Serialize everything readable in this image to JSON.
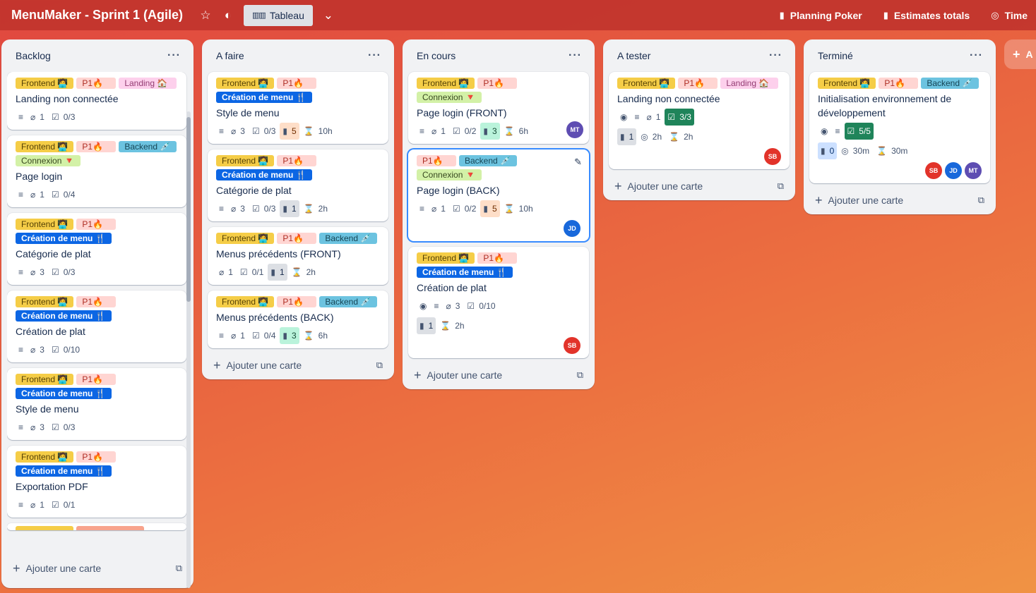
{
  "board": {
    "title": "MenuMaker - Sprint 1 (Agile)",
    "view": "Tableau",
    "powerups": [
      "Planning Poker",
      "Estimates totals",
      "Time"
    ]
  },
  "labels": {
    "frontend": "Frontend 🧑‍💻",
    "p1": "P1🔥",
    "landing": "Landing 🏠",
    "backend": "Backend 💉",
    "connexion": "Connexion 🔻",
    "creation": "Création de menu 🍴"
  },
  "add_card": "Ajouter une carte",
  "add_list": "A",
  "lists": [
    {
      "title": "Backlog",
      "cards": [
        {
          "title": "Landing non connectée",
          "attachments": "1",
          "checklist": "0/3"
        },
        {
          "title": "Page login",
          "attachments": "1",
          "checklist": "0/4"
        },
        {
          "title": "Catégorie de plat",
          "attachments": "3",
          "checklist": "0/3"
        },
        {
          "title": "Création de plat",
          "attachments": "3",
          "checklist": "0/10"
        },
        {
          "title": "Style de menu",
          "attachments": "3",
          "checklist": "0/3"
        },
        {
          "title": "Exportation PDF",
          "attachments": "1",
          "checklist": "0/1"
        }
      ]
    },
    {
      "title": "A faire",
      "cards": [
        {
          "title": "Style de menu",
          "attachments": "3",
          "checklist": "0/3",
          "points": "5",
          "time": "10h"
        },
        {
          "title": "Catégorie de plat",
          "attachments": "3",
          "checklist": "0/3",
          "points": "1",
          "time": "2h"
        },
        {
          "title": "Menus précédents (FRONT)",
          "attachments": "1",
          "checklist": "0/1",
          "points": "1",
          "time": "2h"
        },
        {
          "title": "Menus précédents (BACK)",
          "attachments": "1",
          "checklist": "0/4",
          "points": "3",
          "time": "6h"
        }
      ]
    },
    {
      "title": "En cours",
      "cards": [
        {
          "title": "Page login (FRONT)",
          "attachments": "1",
          "checklist": "0/2",
          "points": "3",
          "time": "6h",
          "member": "MT"
        },
        {
          "title": "Page login (BACK)",
          "attachments": "1",
          "checklist": "0/2",
          "points": "5",
          "time": "10h",
          "member": "JD"
        },
        {
          "title": "Création de plat",
          "attachments": "3",
          "checklist": "0/10",
          "points": "1",
          "time": "2h",
          "member": "SB"
        }
      ]
    },
    {
      "title": "A tester",
      "cards": [
        {
          "title": "Landing non connectée",
          "attachments": "1",
          "checklist": "3/3",
          "points": "1",
          "spent": "2h",
          "time": "2h",
          "member": "SB"
        }
      ]
    },
    {
      "title": "Terminé",
      "cards": [
        {
          "title": "Initialisation environnement de développement",
          "checklist": "5/5",
          "points": "0",
          "spent": "30m",
          "time": "30m",
          "members": [
            "SB",
            "JD",
            "MT"
          ]
        }
      ]
    }
  ]
}
